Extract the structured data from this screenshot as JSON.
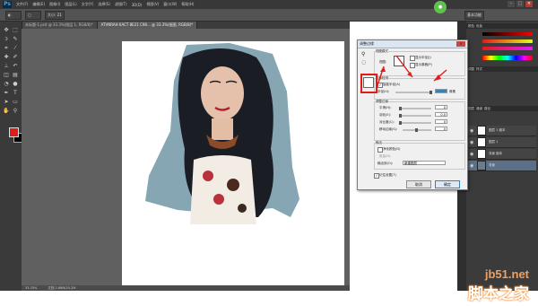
{
  "app": {
    "logo_text": "Ps",
    "menu": [
      "文件(F)",
      "编辑(E)",
      "图像(I)",
      "图层(L)",
      "文字(Y)",
      "选择(S)",
      "滤镜(T)",
      "3D(D)",
      "视图(V)",
      "窗口(W)",
      "帮助(H)"
    ],
    "window_buttons": [
      "–",
      "□",
      "×"
    ]
  },
  "options_bar": {
    "chips": [
      "◐",
      "▢",
      "大小: 21"
    ],
    "mode_label": "基本功能"
  },
  "document_tabs": [
    {
      "label": "未标题-1.psd @ 33.3%(图层 1, RGB/8)*",
      "active": false
    },
    {
      "label": "ATVNRAH 6ACT 8E21 C98... @ 33.3%(抠图, RGB/8)*",
      "active": true
    }
  ],
  "status_bar": {
    "zoom": "33.33%",
    "doc_info": "文档:2.86M/20.2M"
  },
  "dialog": {
    "title": "调整边缘",
    "close_label": "×",
    "view_mode_group": "视图模式",
    "view_label": "视图:",
    "show_radius": "显示半径(J)",
    "show_original": "显示原稿(P)",
    "edge_detection_group": "边缘检测",
    "smart_radius": "智能半径(A)",
    "radius_label": "半径(U):",
    "radius_value": "",
    "radius_unit": "像素",
    "adjust_edge_group": "调整边缘",
    "smooth_label": "平滑(H):",
    "smooth_value": "0",
    "feather_label": "羽化(E):",
    "feather_value": "0.0",
    "contrast_label": "对比度(C):",
    "contrast_value": "0",
    "shift_edge_label": "移动边缘(S):",
    "shift_edge_value": "0",
    "output_group": "输出",
    "decontaminate": "净化颜色(D)",
    "amount_label": "数量(N):",
    "output_to_label": "输出到(O):",
    "output_to_value": "新建图层",
    "remember": "记住设置(T)",
    "cancel": "取消",
    "ok": "确定"
  },
  "layers": [
    {
      "name": "图层 1 副本",
      "selected": false
    },
    {
      "name": "图层 1",
      "selected": false
    },
    {
      "name": "背景 副本",
      "selected": false
    },
    {
      "name": "背景",
      "selected": true
    }
  ],
  "colors": {
    "foreground": "#e21b1b",
    "background": "#000000",
    "annotation": "#e21b1b",
    "accent_blue": "#3c7fb1"
  },
  "watermark": {
    "site": "jb51.net",
    "brand": "脚本之家"
  }
}
